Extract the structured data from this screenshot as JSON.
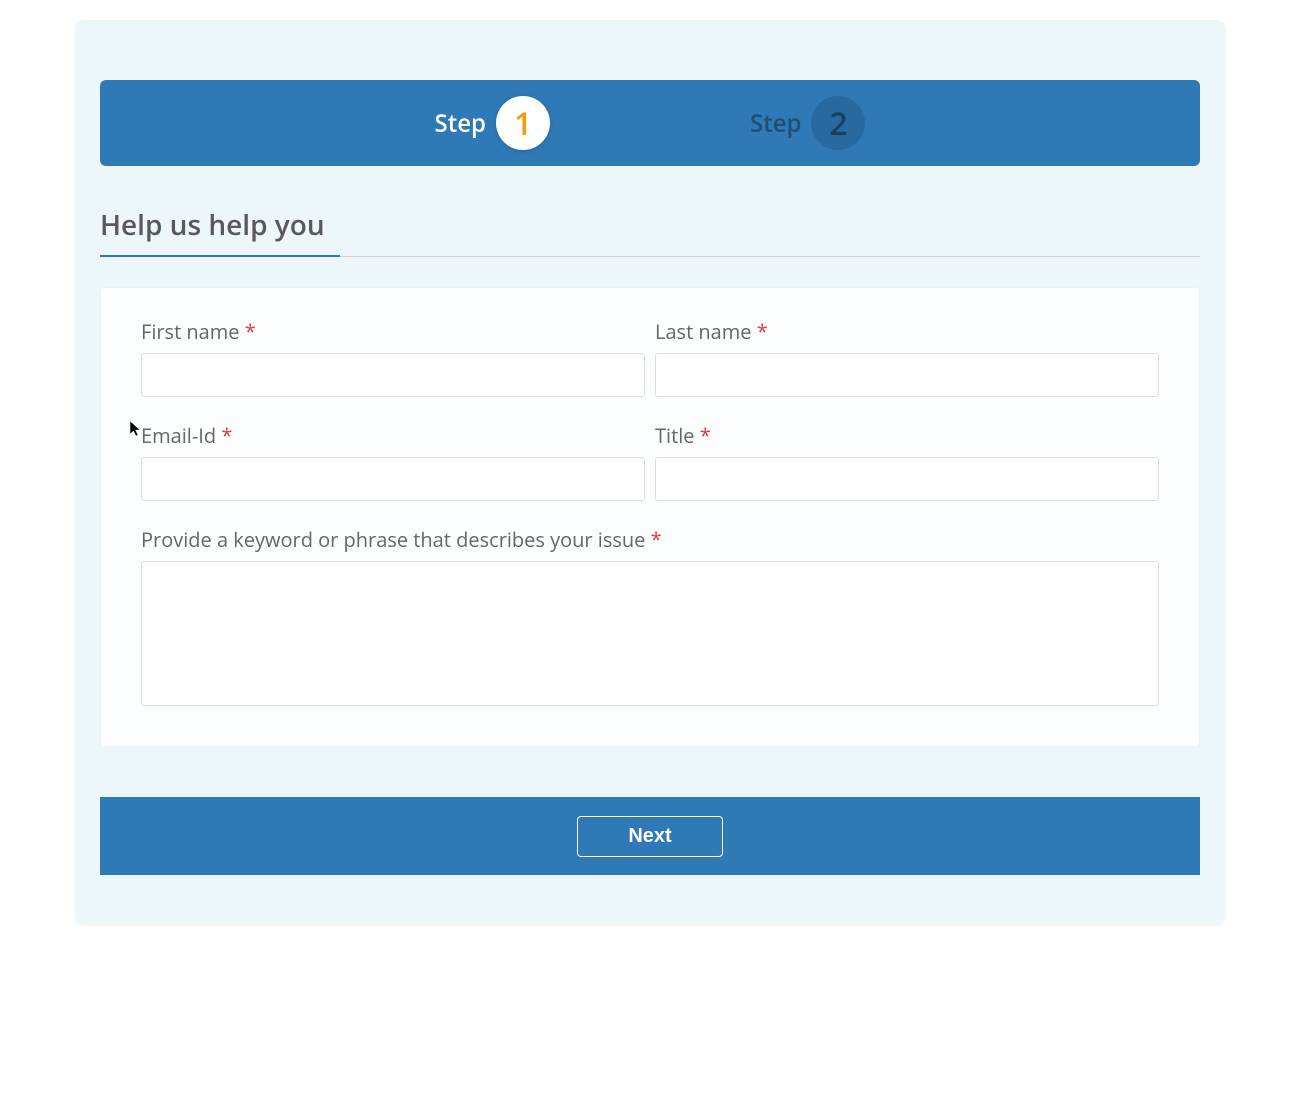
{
  "stepper": {
    "step_label": "Step",
    "steps": [
      {
        "number": "1",
        "active": true
      },
      {
        "number": "2",
        "active": false
      }
    ]
  },
  "section": {
    "title": "Help us help you"
  },
  "form": {
    "first_name": {
      "label": "First name",
      "value": ""
    },
    "last_name": {
      "label": "Last name",
      "value": ""
    },
    "email": {
      "label": "Email-Id",
      "value": ""
    },
    "title": {
      "label": "Title",
      "value": ""
    },
    "description": {
      "label": "Provide a keyword or phrase that describes your issue",
      "value": ""
    }
  },
  "footer": {
    "next_label": "Next"
  },
  "required_marker": "*"
}
